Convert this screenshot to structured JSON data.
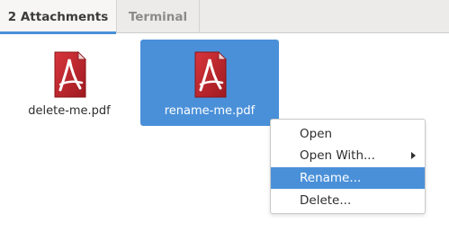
{
  "tabs": [
    {
      "label": "2 Attachments",
      "active": true
    },
    {
      "label": "Terminal",
      "active": false
    }
  ],
  "files": [
    {
      "name": "delete-me.pdf",
      "icon": "pdf-file-icon",
      "selected": false
    },
    {
      "name": "rename-me.pdf",
      "icon": "pdf-file-icon",
      "selected": true
    }
  ],
  "context_menu": {
    "items": [
      {
        "label": "Open"
      },
      {
        "label": "Open With...",
        "has_submenu": true
      },
      {
        "label": "Rename...",
        "highlighted": true
      },
      {
        "label": "Delete..."
      }
    ]
  },
  "colors": {
    "accent": "#4a90d9",
    "pdf_red": "#c0262d"
  }
}
